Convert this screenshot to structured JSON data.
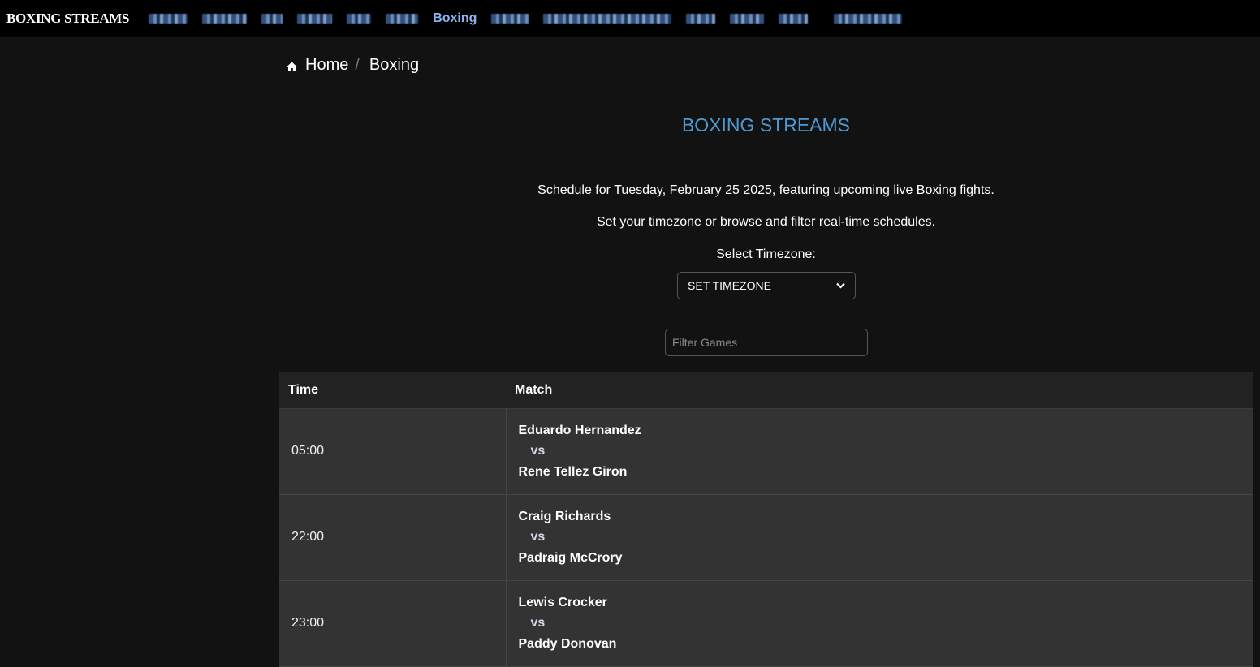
{
  "navbar": {
    "brand": "BOXING STREAMS",
    "items": [
      {
        "label": "",
        "blurred": true,
        "active": false
      },
      {
        "label": "",
        "blurred": true,
        "active": false
      },
      {
        "label": "",
        "blurred": true,
        "active": false
      },
      {
        "label": "",
        "blurred": true,
        "active": false
      },
      {
        "label": "",
        "blurred": true,
        "active": false
      },
      {
        "label": "",
        "blurred": true,
        "active": false
      },
      {
        "label": "Boxing",
        "blurred": false,
        "active": true
      },
      {
        "label": "",
        "blurred": true,
        "active": false
      },
      {
        "label": "",
        "blurred": true,
        "active": false
      },
      {
        "label": "",
        "blurred": true,
        "active": false
      },
      {
        "label": "",
        "blurred": true,
        "active": false
      },
      {
        "label": "",
        "blurred": true,
        "active": false
      },
      {
        "label": "",
        "blurred": true,
        "active": false
      }
    ],
    "active_color": "#8ab4f0"
  },
  "breadcrumb": {
    "icon": "home-icon",
    "items": [
      "Home",
      "Boxing"
    ],
    "separator": "/"
  },
  "main": {
    "title": "BOXING STREAMS",
    "title_color": "#4e9bd4",
    "intro_line1": "Schedule for Tuesday, February 25 2025, featuring upcoming live Boxing fights.",
    "intro_line2": "Set your timezone or browse and filter real-time schedules.",
    "timezone_label": "Select Timezone:",
    "timezone_select": {
      "selected": "SET TIMEZONE",
      "icon": "chevron-down-icon"
    },
    "filter": {
      "placeholder": "Filter Games",
      "value": ""
    }
  },
  "table": {
    "headers": [
      "Time",
      "Match"
    ],
    "rows": [
      {
        "time": "05:00",
        "fighter1": "Eduardo Hernandez",
        "vs": "vs",
        "fighter2": "Rene Tellez Giron"
      },
      {
        "time": "22:00",
        "fighter1": "Craig Richards",
        "vs": "vs",
        "fighter2": "Padraig McCrory"
      },
      {
        "time": "23:00",
        "fighter1": "Lewis Crocker",
        "vs": "vs",
        "fighter2": "Paddy Donovan"
      }
    ]
  }
}
